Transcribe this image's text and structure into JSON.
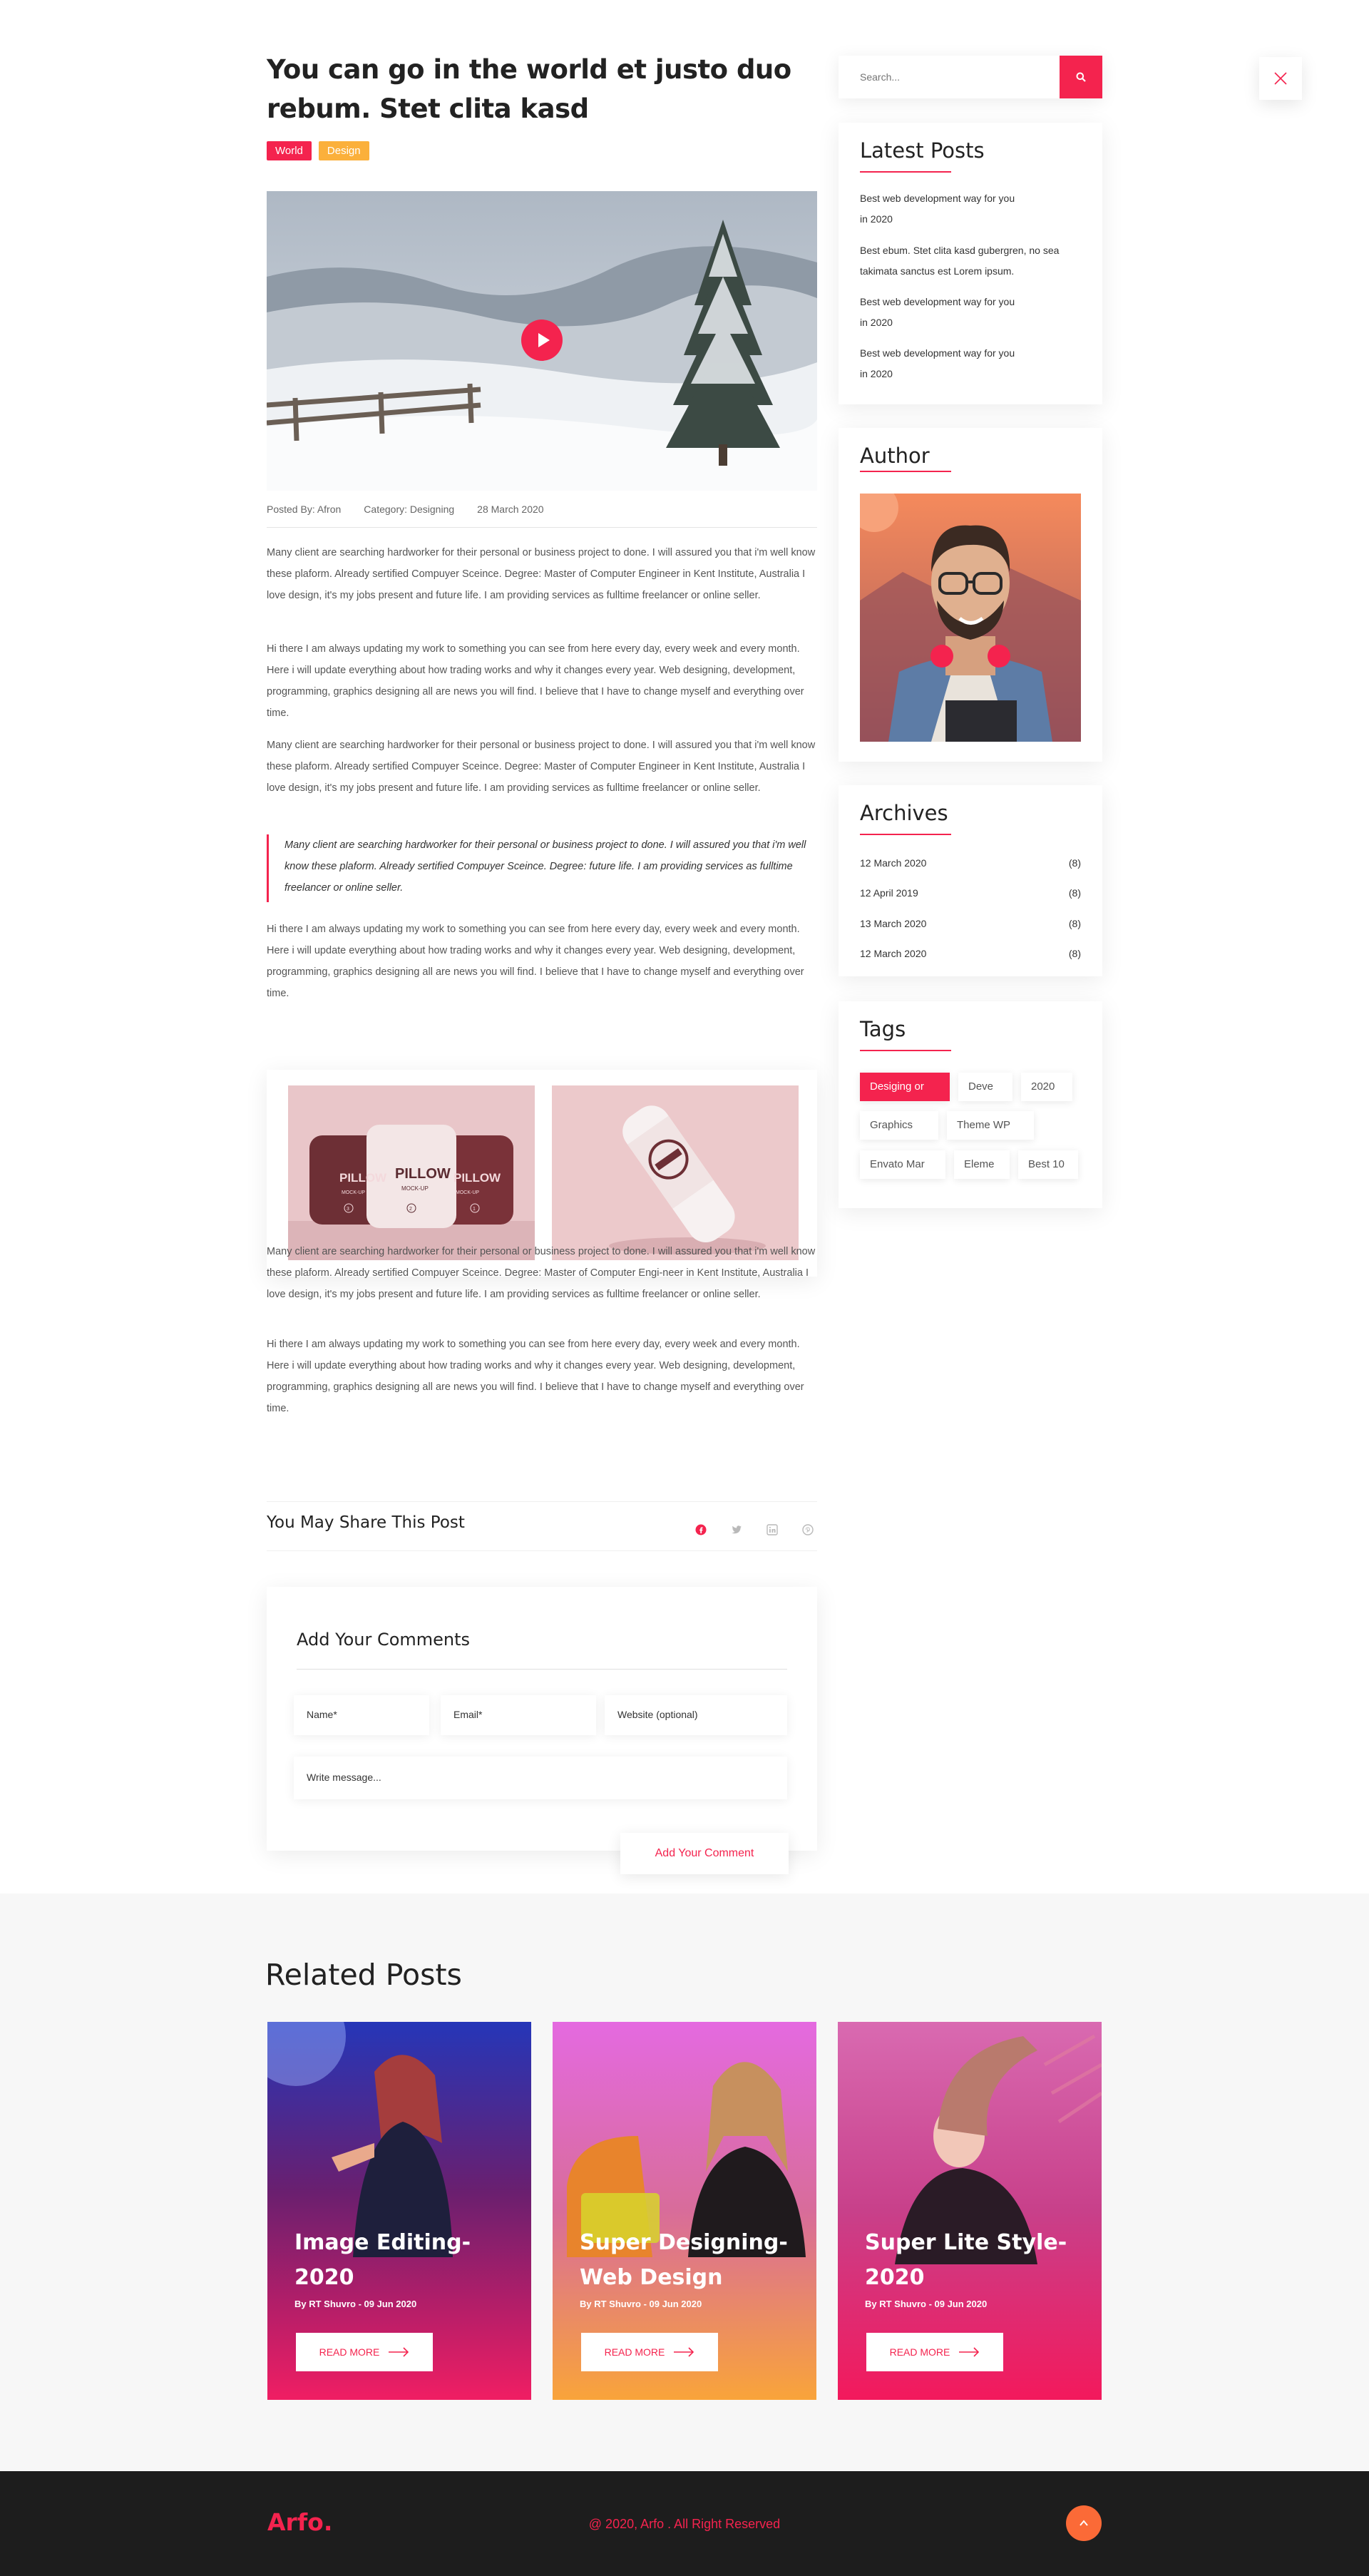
{
  "post": {
    "title_line1": "You can go in the world et justo duo",
    "title_line2": "rebum. Stet clita kasd",
    "categories": [
      "World",
      "Design"
    ],
    "meta": {
      "posted_by": "Posted By: Afron",
      "category": "Category: Designing",
      "date": "28 March 2020"
    },
    "paragraphs": [
      "Many client are searching hardworker for their personal or business project to done. I will assured you that i'm well know these plaform. Already sertified Compuyer Sceince. Degree: Master of Computer Engineer in Kent Institute, Australia I love design, it's my jobs present and future life. I am providing services as fulltime freelancer or online seller.",
      "Hi there I am always updating my work to something you can see from here every day, every week and every month. Here i will update everything about how trading works and why it changes every year. Web designing, development, programming, graphics designing all are news you will find. I believe that I have to change myself and everything over time.",
      "Many client are searching hardworker for their personal or business project to done. I will assured you that i'm well know these plaform. Already sertified Compuyer Sceince. Degree: Master of Computer Engineer in Kent Institute, Australia I love design, it's my jobs present and future life. I am providing services as fulltime freelancer or online seller.",
      "Hi there I am always updating my work to something you can see from here every day, every week and every month. Here i will update everything about how trading works and why it changes every year. Web designing, development, programming, graphics designing all are news you will find. I believe that I have to change myself and everything over time.",
      "Many client are searching hardworker for their personal or business project to done. I will assured you that i'm well know these plaform. Already sertified Compuyer Sceince. Degree: Master of Computer Engi-neer in Kent Institute, Australia I love design, it's my jobs present and future life. I am providing services as fulltime freelancer or online seller.",
      "Hi there I am always updating my work to something you can see from here every day, every week and every month. Here i will update everything about how trading works and why it changes every year. Web designing, development, programming, graphics designing all are news you will find. I believe that I have to change myself and everything over time."
    ],
    "quote": "Many client are searching hardworker for their personal or business project to done. I will assured you that i'm well know these plaform. Already sertified Compuyer Sceince. Degree: future life. I am providing services as fulltime freelancer or online seller.",
    "gallery": {
      "pillow_words": [
        "PILLOW",
        "PILLOW",
        "PILLOW"
      ],
      "pillow_sub": [
        "MOCK-UP",
        "MOCK-UP",
        "MOCK-UP"
      ],
      "pillow_badge": [
        "3",
        "2",
        "1"
      ]
    },
    "share_title": "You May Share This Post",
    "share_icons": [
      "facebook-icon",
      "twitter-icon",
      "linkedin-icon",
      "pinterest-icon"
    ]
  },
  "comments": {
    "title": "Add Your Comments",
    "name_placeholder": "Name*",
    "email_placeholder": "Email*",
    "website_placeholder": "Website (optional)",
    "message_placeholder": "Write message...",
    "submit_label": "Add Your Comment"
  },
  "sidebar": {
    "search_placeholder": "Search...",
    "latest": {
      "title": "Latest Posts",
      "items": [
        {
          "l1": "Best web development way for you",
          "l2": "in 2020"
        },
        {
          "l1": "Best ebum. Stet clita kasd gubergren, no sea",
          "l2": "takimata sanctus est Lorem ipsum."
        },
        {
          "l1": "Best web development way for you",
          "l2": "in 2020"
        },
        {
          "l1": "Best web development way for you",
          "l2": "in 2020"
        }
      ]
    },
    "author_title": "Author",
    "archives": {
      "title": "Archives",
      "items": [
        {
          "date": "12 March 2020",
          "count": "(8)"
        },
        {
          "date": "12 April 2019",
          "count": "(8)"
        },
        {
          "date": "13 March 2020",
          "count": "(8)"
        },
        {
          "date": "12 March 2020",
          "count": "(8)"
        }
      ]
    },
    "tags": {
      "title": "Tags",
      "items": [
        "Desiging or",
        "Deve",
        "2020",
        "Graphics",
        "Theme WP",
        "Envato Mar",
        "Eleme",
        "Best 10"
      ]
    }
  },
  "related": {
    "title": "Related Posts",
    "cards": [
      {
        "title_l1": "Image Editing-",
        "title_l2": "2020",
        "meta": "By RT Shuvro - 09 Jun 2020",
        "button": "READ MORE"
      },
      {
        "title_l1": "Super Designing-",
        "title_l2": "Web Design",
        "meta": "By RT Shuvro - 09 Jun 2020",
        "button": "READ MORE"
      },
      {
        "title_l1": "Super Lite Style-",
        "title_l2": "2020",
        "meta": "By RT Shuvro - 09 Jun 2020",
        "button": "READ MORE"
      }
    ]
  },
  "footer": {
    "logo": "Arfo.",
    "copyright": "@ 2020, Arfo . All Right Reserved"
  },
  "colors": {
    "accent": "#f4234e",
    "orange": "#fbb03b",
    "totop": "#fb6a37",
    "footer_bg": "#1d1d1d"
  }
}
